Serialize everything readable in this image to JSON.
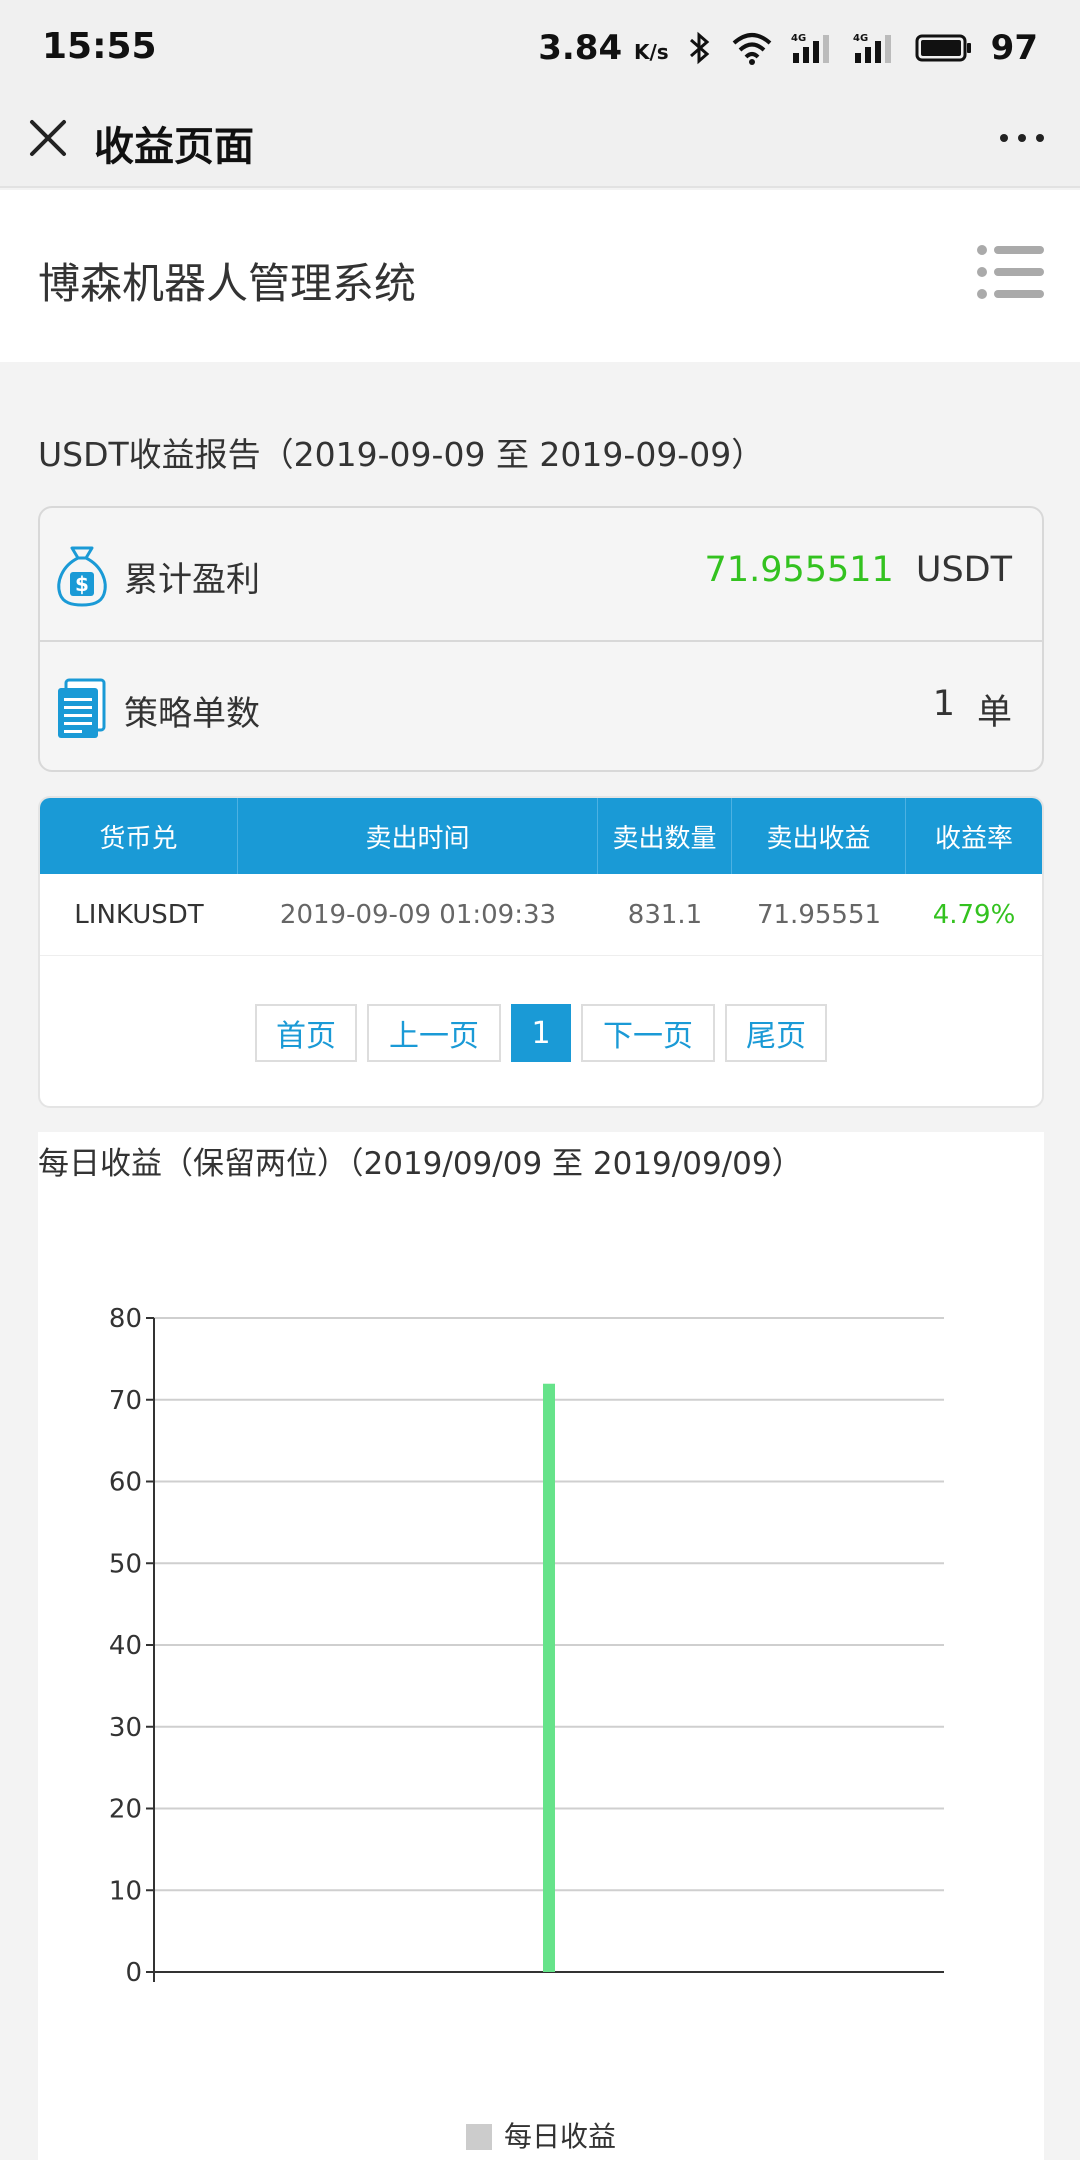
{
  "status_bar": {
    "time": "15:55",
    "speed": "3.84",
    "speed_unit": "K/s",
    "battery": "97",
    "icons": [
      "bluetooth-icon",
      "wifi-icon",
      "signal-4g-icon",
      "signal-4g-icon",
      "battery-icon"
    ]
  },
  "titlebar": {
    "title": "收益页面",
    "close_icon": "close-icon",
    "more_icon": "more-icon"
  },
  "app": {
    "title": "博森机器人管理系统",
    "menu_icon": "list-menu-icon"
  },
  "report": {
    "title": "USDT收益报告（2019-09-09 至 2019-09-09）",
    "profit_label": "累计盈利",
    "profit_value": "71.955511",
    "profit_unit": "USDT",
    "orders_label": "策略单数",
    "orders_value": "1",
    "orders_unit": "单"
  },
  "table": {
    "headers": [
      "货币兑",
      "卖出时间",
      "卖出数量",
      "卖出收益",
      "收益率"
    ],
    "rows": [
      [
        "LINKUSDT",
        "2019-09-09 01:09:33",
        "831.1",
        "71.95551",
        "4.79%"
      ]
    ]
  },
  "pager": {
    "first": "首页",
    "prev": "上一页",
    "current": "1",
    "next": "下一页",
    "last": "尾页"
  },
  "colors": {
    "accent": "#1a9ad6",
    "positive": "#33c21f",
    "bar": "#66e38a"
  },
  "chart_data": {
    "type": "bar",
    "title": "每日收益（保留两位）（2019/09/09 至 2019/09/09）",
    "categories": [
      ""
    ],
    "series": [
      {
        "name": "每日收益",
        "values": [
          71.96
        ]
      }
    ],
    "ylim": [
      0,
      80
    ],
    "yticks": [
      0,
      10,
      20,
      30,
      40,
      50,
      60,
      70,
      80
    ],
    "grid": true,
    "legend": "bottom"
  }
}
